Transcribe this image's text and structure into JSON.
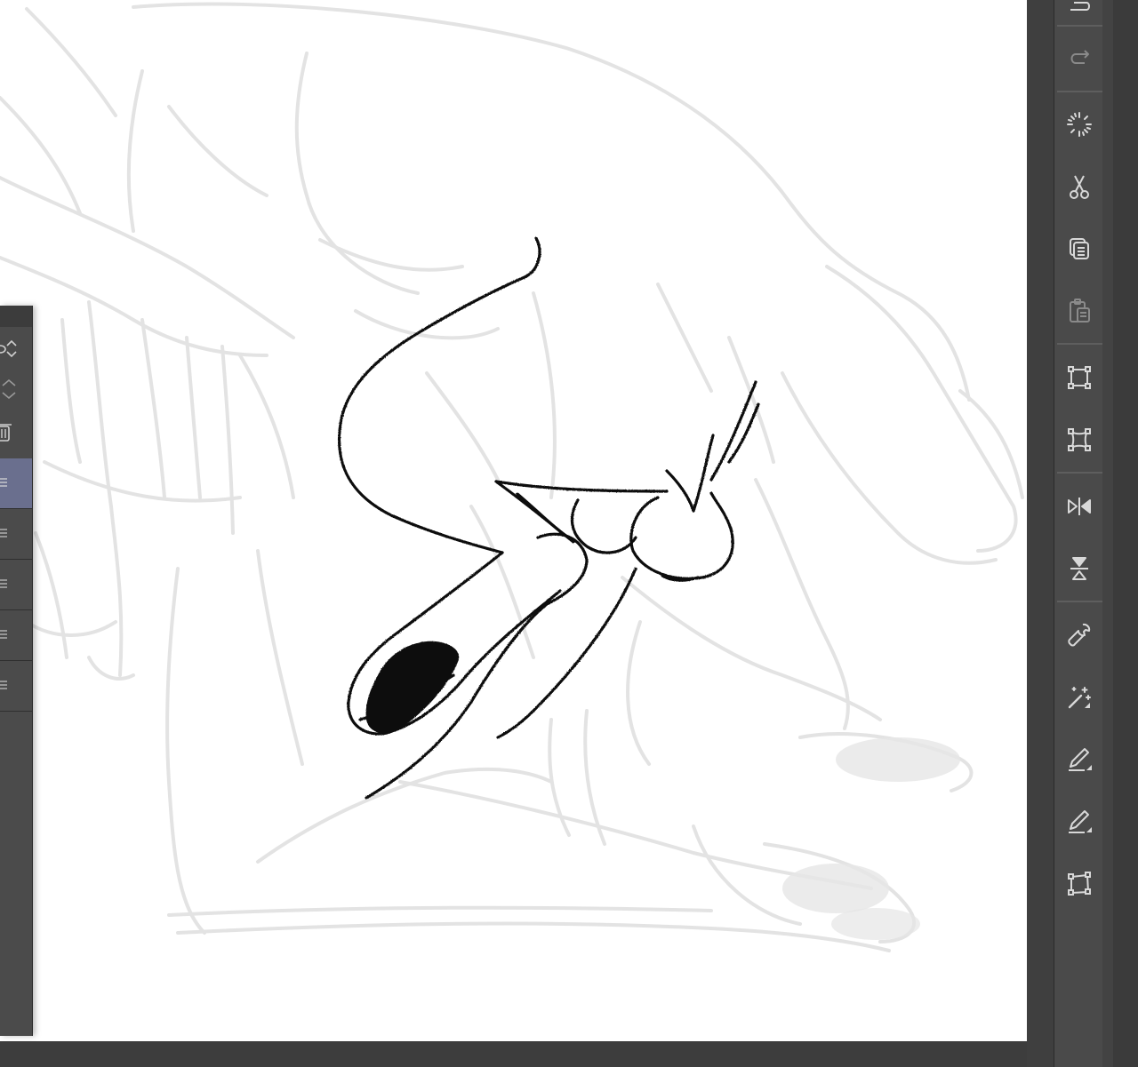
{
  "app": {
    "colors": {
      "canvas": "#ffffff",
      "panel_background": "#4a4a4a",
      "selected_layer": "#6a6f8e",
      "icon": "#d8d8d8",
      "sketch_line": "#111111",
      "rough_sketch": "#e2e2e2"
    }
  },
  "command_bar": {
    "buttons": [
      {
        "name": "undo-button",
        "icon": "undo-icon",
        "enabled": true
      },
      {
        "name": "redo-button",
        "icon": "redo-icon",
        "enabled": false
      },
      {
        "name": "deselect-button",
        "icon": "deselect-icon",
        "enabled": true
      },
      {
        "name": "cut-button",
        "icon": "scissors-icon",
        "enabled": true
      },
      {
        "name": "copy-button",
        "icon": "copy-icon",
        "enabled": true
      },
      {
        "name": "paste-button",
        "icon": "paste-icon",
        "enabled": false
      },
      {
        "name": "scale-rotate-button",
        "icon": "transform-box-icon",
        "enabled": true
      },
      {
        "name": "free-transform-button",
        "icon": "free-transform-icon",
        "enabled": true
      },
      {
        "name": "flip-horizontal-button",
        "icon": "flip-horizontal-icon",
        "enabled": true
      },
      {
        "name": "flip-vertical-button",
        "icon": "flip-vertical-icon",
        "enabled": true
      },
      {
        "name": "settings-button",
        "icon": "wrench-icon",
        "enabled": true
      },
      {
        "name": "auto-select-button",
        "icon": "magic-wand-icon",
        "enabled": true
      },
      {
        "name": "fill-selection-button",
        "icon": "pen-fill-icon",
        "enabled": true
      },
      {
        "name": "stroke-selection-button",
        "icon": "pen-stroke-icon",
        "enabled": true
      },
      {
        "name": "crop-button",
        "icon": "crop-frame-icon",
        "enabled": true
      }
    ]
  },
  "layers_panel": {
    "layers": [
      {
        "name": "layer-1",
        "selected": true
      },
      {
        "name": "layer-2",
        "selected": false
      },
      {
        "name": "layer-3",
        "selected": false
      },
      {
        "name": "layer-4",
        "selected": false
      },
      {
        "name": "layer-5",
        "selected": false
      }
    ]
  }
}
